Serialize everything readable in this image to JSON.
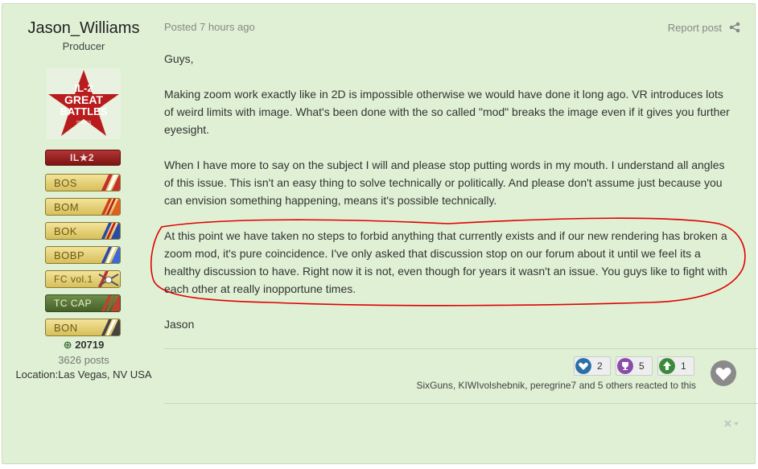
{
  "author": {
    "name": "Jason_Williams",
    "role": "Producer",
    "logo_text": [
      "IL-2",
      "GREAT",
      "BATTLES",
      "SERIES"
    ],
    "badges": [
      {
        "code": "IL★2",
        "style": "il2"
      },
      {
        "code": "BOS",
        "style": "gold"
      },
      {
        "code": "BOM",
        "style": "gold"
      },
      {
        "code": "BOK",
        "style": "gold"
      },
      {
        "code": "BOBP",
        "style": "gold"
      },
      {
        "code": "FC vol.1",
        "style": "gold"
      },
      {
        "code": "TC CAP",
        "style": "tc"
      },
      {
        "code": "BON",
        "style": "gold"
      }
    ],
    "reputation": "20719",
    "posts": "3626 posts",
    "location": "Location:Las Vegas, NV USA"
  },
  "post": {
    "posted": "Posted 7 hours ago",
    "report": "Report post",
    "paragraphs": [
      "Guys,",
      "Making zoom work exactly like in 2D is impossible otherwise we would have done it long ago. VR introduces lots of weird limits with image. What's been done with the so called \"mod\" breaks the image even if it gives you further eyesight.",
      "When I have more to say on the subject I will and please stop putting words in my mouth. I understand all angles of this issue. This isn't an easy thing to solve technically or politically. And please don't assume just because you can envision something happening, means it's possible technically.",
      "At this point we have taken no steps to forbid anything that currently exists and if our new rendering has broken a zoom mod, it's pure coincidence. I've only asked that discussion stop on our forum about it until we feel its a healthy discussion to have. Right now it is not, even though for years it wasn't an issue. You guys like to fight with each other at really inopportune times.",
      "Jason"
    ]
  },
  "reactions": {
    "items": [
      {
        "icon": "like-icon",
        "count": "2",
        "color": "#2a6fa8"
      },
      {
        "icon": "trophy-icon",
        "count": "5",
        "color": "#8a4ca8"
      },
      {
        "icon": "upvote-icon",
        "count": "1",
        "color": "#3a8a3a"
      }
    ],
    "reactors": "SixGuns, KIWIvolshebnik, peregrine7 and 5 others reacted to this"
  },
  "colors": {
    "post_bg": "#dff0d4",
    "annotation_ring": "#e00000"
  }
}
